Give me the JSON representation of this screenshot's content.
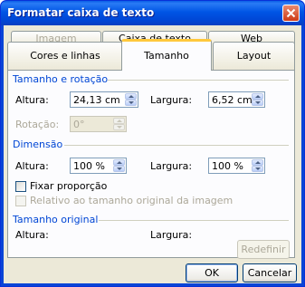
{
  "window": {
    "title": "Formatar caixa de texto"
  },
  "tabs": {
    "row1": [
      "Imagem",
      "Caixa de texto",
      "Web"
    ],
    "row2": [
      "Cores e linhas",
      "Tamanho",
      "Layout"
    ]
  },
  "size_rotation": {
    "heading": "Tamanho e rotação",
    "height_label": "Altura:",
    "height_value": "24,13 cm",
    "width_label": "Largura:",
    "width_value": "6,52 cm",
    "rotation_label": "Rotação:",
    "rotation_value": "0°"
  },
  "scale": {
    "heading": "Dimensão",
    "height_label": "Altura:",
    "height_value": "100 %",
    "width_label": "Largura:",
    "width_value": "100 %",
    "lock_aspect": "Fixar proporção",
    "relative_original": "Relativo ao tamanho original da imagem"
  },
  "original": {
    "heading": "Tamanho original",
    "height_label": "Altura:",
    "width_label": "Largura:",
    "reset": "Redefinir"
  },
  "buttons": {
    "ok": "OK",
    "cancel": "Cancelar"
  }
}
